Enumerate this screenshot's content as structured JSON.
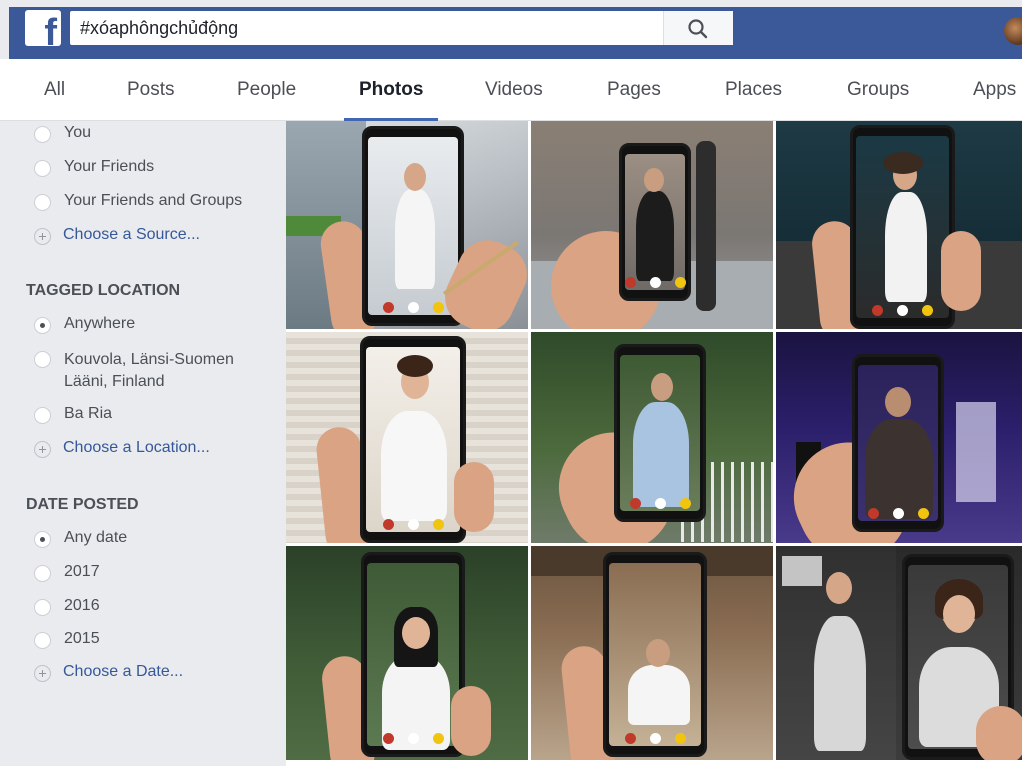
{
  "header": {
    "logo_letter": "f",
    "search_value": "#xóaphôngchủđộng",
    "search_icon": "search-icon",
    "brand_color": "#3b5998"
  },
  "tabs": [
    {
      "label": "All"
    },
    {
      "label": "Posts"
    },
    {
      "label": "People"
    },
    {
      "label": "Photos",
      "active": true
    },
    {
      "label": "Videos"
    },
    {
      "label": "Pages"
    },
    {
      "label": "Places"
    },
    {
      "label": "Groups"
    },
    {
      "label": "Apps"
    }
  ],
  "sidebar": {
    "source_options": [
      "You",
      "Your Friends",
      "Your Friends and Groups"
    ],
    "source_more": "Choose a Source...",
    "location_title": "TAGGED LOCATION",
    "location_options": [
      "Anywhere",
      "Kouvola, Länsi-Suomen Lääni, Finland",
      "Ba Ria"
    ],
    "location_selected": "Anywhere",
    "location_more": "Choose a Location...",
    "date_title": "DATE POSTED",
    "date_options": [
      "Any date",
      "2017",
      "2016",
      "2015"
    ],
    "date_selected": "Any date",
    "date_more": "Choose a Date..."
  },
  "photos": {
    "count": 9,
    "accent_colors": [
      "#c0392b",
      "#ffffff",
      "#f1c40f"
    ]
  }
}
